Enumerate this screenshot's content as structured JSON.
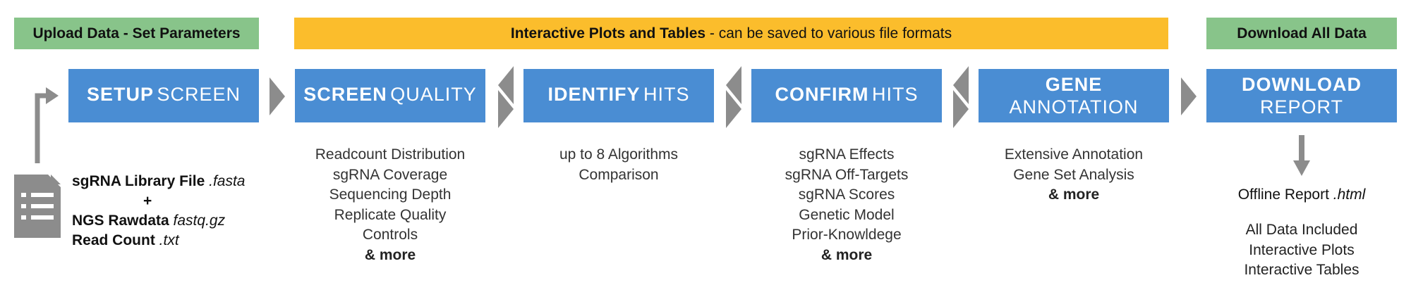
{
  "banners": {
    "upload": "Upload Data - Set Parameters",
    "interactive_bold": "Interactive Plots and Tables",
    "interactive_rest": " - can be saved to various file formats",
    "download": "Download All Data"
  },
  "steps": [
    {
      "bold": "SETUP",
      "light": "SCREEN"
    },
    {
      "bold": "SCREEN",
      "light": "QUALITY"
    },
    {
      "bold": "IDENTIFY",
      "light": "HITS"
    },
    {
      "bold": "CONFIRM",
      "light": "HITS"
    },
    {
      "bold": "GENE",
      "light": "ANNOTATION"
    },
    {
      "bold": "DOWNLOAD",
      "light": "REPORT"
    }
  ],
  "inputs": {
    "library_label": "sgRNA Library File",
    "library_ext": ".fasta",
    "plus": "+",
    "ngs_label": "NGS Rawdata",
    "ngs_ext": "fastq.gz",
    "readcount_label": "Read Count",
    "readcount_ext": ".txt"
  },
  "screen_quality": [
    "Readcount Distribution",
    "sgRNA Coverage",
    "Sequencing Depth",
    "Replicate Quality",
    "Controls"
  ],
  "screen_quality_more": "& more",
  "identify_hits": [
    "up to 8 Algorithms",
    "Comparison"
  ],
  "confirm_hits": [
    "sgRNA Effects",
    "sgRNA Off-Targets",
    "sgRNA Scores",
    "Genetic Model",
    "Prior-Knowldege"
  ],
  "confirm_hits_more": "& more",
  "gene_annotation": [
    "Extensive Annotation",
    "Gene Set Analysis"
  ],
  "gene_annotation_more": "& more",
  "report": {
    "label": "Offline Report",
    "ext": ".html",
    "features": [
      "All Data Included",
      "Interactive Plots",
      "Interactive Tables"
    ]
  },
  "colors": {
    "step_blue": "#4a8dd3",
    "banner_green": "#88c48a",
    "banner_yellow": "#fbbd2c",
    "arrow_gray": "#8c8c8c"
  }
}
